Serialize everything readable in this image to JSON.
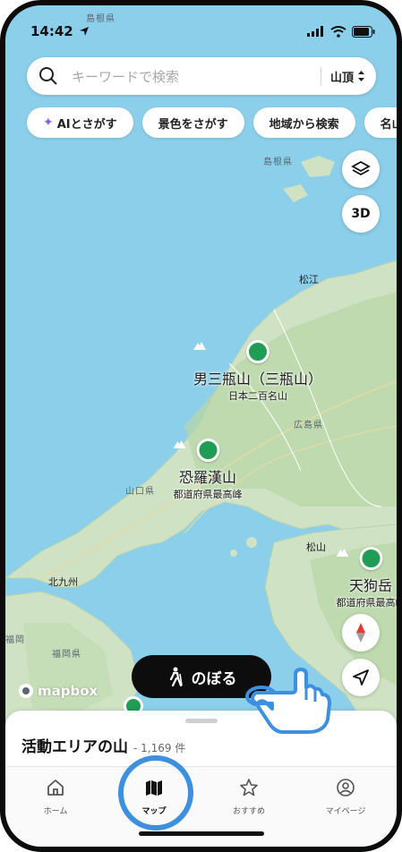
{
  "status_bar": {
    "time": "14:42"
  },
  "search": {
    "placeholder": "キーワードで検索",
    "sort_label": "山頂"
  },
  "chips": [
    "AIとさがす",
    "景色をさがす",
    "地域から検索",
    "名山"
  ],
  "map": {
    "controls": {
      "three_d_label": "3D"
    },
    "region_labels": {
      "shimane_top": "島根県",
      "shimane": "島根県",
      "hiroshima": "広島県",
      "yamaguchi": "山口県",
      "fukuoka": "福岡県",
      "fukuoka_edge": "福岡"
    },
    "city_labels": {
      "matsue": "松江",
      "matsuyama": "松山",
      "kitakyushu": "北九州"
    },
    "peaks": [
      {
        "name": "男三瓶山（三瓶山）",
        "subtitle": "日本二百名山"
      },
      {
        "name": "恐羅漢山",
        "subtitle": "都道府県最高峰"
      },
      {
        "name": "天狗岳",
        "subtitle": "都道府県最高峰"
      }
    ],
    "attribution": "mapbox"
  },
  "climb_button": {
    "label": "のぼる"
  },
  "sheet": {
    "title": "活動エリアの山",
    "count": "- 1,169 件"
  },
  "tabs": [
    {
      "label": "ホーム",
      "icon": "home-icon"
    },
    {
      "label": "マップ",
      "icon": "map-icon"
    },
    {
      "label": "おすすめ",
      "icon": "star-icon"
    },
    {
      "label": "マイページ",
      "icon": "user-icon"
    }
  ],
  "colors": {
    "accent_ring": "#3d8fe0",
    "peak_green": "#1f9d55",
    "sea": "#8ccfea",
    "land": "#cfe3c4"
  }
}
